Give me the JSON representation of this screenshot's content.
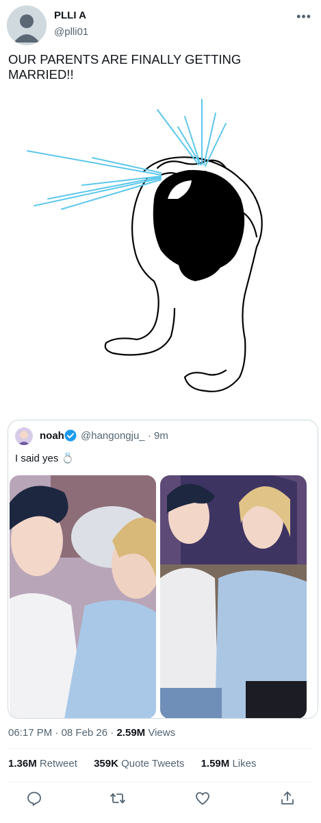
{
  "author": {
    "name": "PLLI A",
    "handle": "@plli01"
  },
  "tweet": {
    "text": "OUR PARENTS ARE FINALLY GETTING MARRIED!!"
  },
  "quoted_tweet": {
    "name": "noah",
    "handle": "@hangongju_",
    "separator": "·",
    "time": "9m",
    "text": "I said yes 💍"
  },
  "meta": {
    "time": "06:17 PM",
    "date": "08 Feb 26",
    "views_count": "2.59M",
    "views_label": "Views"
  },
  "stats": {
    "retweets_count": "1.36M",
    "retweets_label": "Retweet",
    "quotes_count": "359K",
    "quotes_label": "Quote Tweets",
    "likes_count": "1.59M",
    "likes_label": "Likes"
  },
  "colors": {
    "verified": "#1d9bf0",
    "tear": "#5bc7ec",
    "muted": "#536471"
  },
  "icons": {
    "more": "more-icon",
    "reply": "reply-icon",
    "retweet": "retweet-icon",
    "like": "heart-icon",
    "share": "share-icon"
  }
}
